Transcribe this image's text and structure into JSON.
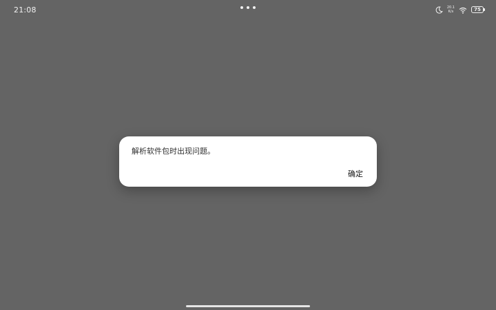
{
  "status_bar": {
    "time": "21:08",
    "net_speed_value": "20.1",
    "net_speed_unit": "K/s",
    "battery_level": "75",
    "icons": [
      "moon-icon",
      "wifi-icon",
      "battery-icon"
    ]
  },
  "dialog": {
    "message": "解析软件包时出现问题。",
    "confirm_label": "确定"
  },
  "colors": {
    "background": "#646464",
    "dialog": "#ffffff",
    "status_text": "#f2f2f2"
  }
}
